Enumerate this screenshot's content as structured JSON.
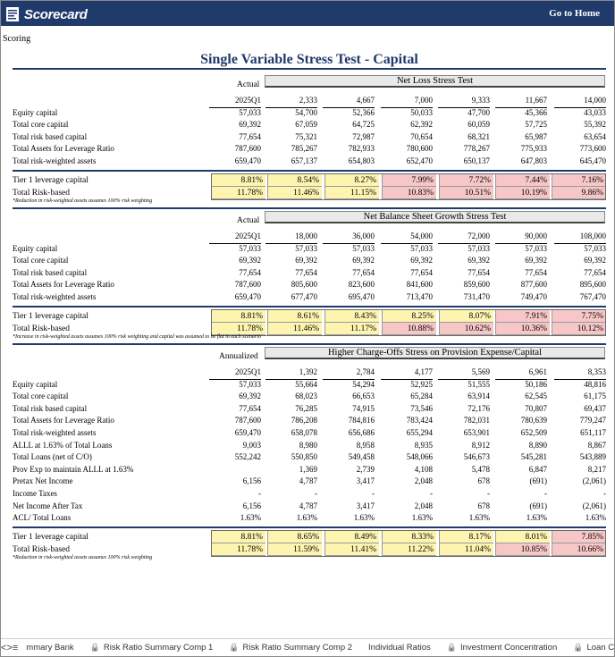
{
  "header": {
    "logo_text": "Scorecard",
    "go_home": "Go to Home"
  },
  "breadcrumb": "Scoring",
  "page_title": "Single Variable Stress Test - Capital",
  "sections": [
    {
      "left_label": "Actual",
      "box_title": "Net Loss Stress Test",
      "columns": [
        "2025Q1",
        "2,333",
        "4,667",
        "7,000",
        "9,333",
        "11,667",
        "14,000"
      ],
      "rows": [
        {
          "label": "Equity capital",
          "values": [
            "57,033",
            "54,700",
            "52,366",
            "50,033",
            "47,700",
            "45,366",
            "43,033"
          ]
        },
        {
          "label": "Total core capital",
          "values": [
            "69,392",
            "67,059",
            "64,725",
            "62,392",
            "60,059",
            "57,725",
            "55,392"
          ]
        },
        {
          "label": "Total risk based capital",
          "values": [
            "77,654",
            "75,321",
            "72,987",
            "70,654",
            "68,321",
            "65,987",
            "63,654"
          ]
        },
        {
          "label": "Total Assets for Leverage Ratio",
          "values": [
            "787,600",
            "785,267",
            "782,933",
            "780,600",
            "778,267",
            "775,933",
            "773,600"
          ]
        },
        {
          "label": "Total risk-weighted assets",
          "values": [
            "659,470",
            "657,137",
            "654,803",
            "652,470",
            "650,137",
            "647,803",
            "645,470"
          ]
        }
      ],
      "ratios": [
        {
          "label": "Tier 1 leverage capital",
          "values": [
            "8.81%",
            "8.54%",
            "8.27%",
            "7.99%",
            "7.72%",
            "7.44%",
            "7.16%"
          ],
          "colors": [
            "y",
            "y",
            "y",
            "p",
            "p",
            "p",
            "p"
          ]
        },
        {
          "label": "Total Risk-based",
          "values": [
            "11.78%",
            "11.46%",
            "11.15%",
            "10.83%",
            "10.51%",
            "10.19%",
            "9.86%"
          ],
          "colors": [
            "y",
            "y",
            "y",
            "p",
            "p",
            "p",
            "p"
          ]
        }
      ],
      "footnote": "*Reduction in risk-weighted assets assumes 100% risk weighting"
    },
    {
      "left_label": "Actual",
      "box_title": "Net Balance Sheet Growth Stress Test",
      "columns": [
        "2025Q1",
        "18,000",
        "36,000",
        "54,000",
        "72,000",
        "90,000",
        "108,000"
      ],
      "rows": [
        {
          "label": "Equity capital",
          "values": [
            "57,033",
            "57,033",
            "57,033",
            "57,033",
            "57,033",
            "57,033",
            "57,033"
          ]
        },
        {
          "label": "Total core capital",
          "values": [
            "69,392",
            "69,392",
            "69,392",
            "69,392",
            "69,392",
            "69,392",
            "69,392"
          ]
        },
        {
          "label": "Total risk based capital",
          "values": [
            "77,654",
            "77,654",
            "77,654",
            "77,654",
            "77,654",
            "77,654",
            "77,654"
          ]
        },
        {
          "label": "Total Assets for Leverage Ratio",
          "values": [
            "787,600",
            "805,600",
            "823,600",
            "841,600",
            "859,600",
            "877,600",
            "895,600"
          ]
        },
        {
          "label": "Total risk-weighted assets",
          "values": [
            "659,470",
            "677,470",
            "695,470",
            "713,470",
            "731,470",
            "749,470",
            "767,470"
          ]
        }
      ],
      "ratios": [
        {
          "label": "Tier 1 leverage capital",
          "values": [
            "8.81%",
            "8.61%",
            "8.43%",
            "8.25%",
            "8.07%",
            "7.91%",
            "7.75%"
          ],
          "colors": [
            "y",
            "y",
            "y",
            "y",
            "y",
            "p",
            "p"
          ]
        },
        {
          "label": "Total Risk-based",
          "values": [
            "11.78%",
            "11.46%",
            "11.17%",
            "10.88%",
            "10.62%",
            "10.36%",
            "10.12%"
          ],
          "colors": [
            "y",
            "y",
            "y",
            "p",
            "p",
            "p",
            "p"
          ]
        }
      ],
      "footnote": "*Increase in risk-weighted assets assumes 100% risk weighting and capital was assumed to be flat in each scenario"
    },
    {
      "left_label": "Annualized",
      "box_title": "Higher Charge-Offs Stress on Provision Expense/Capital",
      "columns": [
        "2025Q1",
        "1,392",
        "2,784",
        "4,177",
        "5,569",
        "6,961",
        "8,353"
      ],
      "rows": [
        {
          "label": "Equity capital",
          "values": [
            "57,033",
            "55,664",
            "54,294",
            "52,925",
            "51,555",
            "50,186",
            "48,816"
          ]
        },
        {
          "label": "Total core capital",
          "values": [
            "69,392",
            "68,023",
            "66,653",
            "65,284",
            "63,914",
            "62,545",
            "61,175"
          ]
        },
        {
          "label": "Total risk based capital",
          "values": [
            "77,654",
            "76,285",
            "74,915",
            "73,546",
            "72,176",
            "70,807",
            "69,437"
          ]
        },
        {
          "label": "Total Assets for Leverage Ratio",
          "values": [
            "787,600",
            "786,208",
            "784,816",
            "783,424",
            "782,031",
            "780,639",
            "779,247"
          ]
        },
        {
          "label": "Total risk-weighted assets",
          "values": [
            "659,470",
            "658,078",
            "656,686",
            "655,294",
            "653,901",
            "652,509",
            "651,117"
          ]
        },
        {
          "label": "ALLL at 1.63% of Total Loans",
          "values": [
            "9,003",
            "8,980",
            "8,958",
            "8,935",
            "8,912",
            "8,890",
            "8,867"
          ]
        },
        {
          "label": "Total Loans (net of C/O)",
          "values": [
            "552,242",
            "550,850",
            "549,458",
            "548,066",
            "546,673",
            "545,281",
            "543,889"
          ]
        },
        {
          "label": "Prov Exp to maintain ALLL at 1.63%",
          "values": [
            "",
            "1,369",
            "2,739",
            "4,108",
            "5,478",
            "6,847",
            "8,217"
          ]
        },
        {
          "label": "Pretax Net Income",
          "values": [
            "6,156",
            "4,787",
            "3,417",
            "2,048",
            "678",
            "(691)",
            "(2,061)"
          ]
        },
        {
          "label": "Income Taxes",
          "values": [
            "-",
            "-",
            "-",
            "-",
            "-",
            "-",
            "-"
          ]
        },
        {
          "label": "Net Income After Tax",
          "values": [
            "6,156",
            "4,787",
            "3,417",
            "2,048",
            "678",
            "(691)",
            "(2,061)"
          ]
        },
        {
          "label": "ACL/ Total Loans",
          "values": [
            "1.63%",
            "1.63%",
            "1.63%",
            "1.63%",
            "1.63%",
            "1.63%",
            "1.63%"
          ]
        }
      ],
      "ratios": [
        {
          "label": "Tier 1 leverage capital",
          "values": [
            "8.81%",
            "8.65%",
            "8.49%",
            "8.33%",
            "8.17%",
            "8.01%",
            "7.85%"
          ],
          "colors": [
            "y",
            "y",
            "y",
            "y",
            "y",
            "y",
            "p"
          ]
        },
        {
          "label": "Total Risk-based",
          "values": [
            "11.78%",
            "11.59%",
            "11.41%",
            "11.22%",
            "11.04%",
            "10.85%",
            "10.66%"
          ],
          "colors": [
            "y",
            "y",
            "y",
            "y",
            "y",
            "p",
            "p"
          ]
        }
      ],
      "footnote": "*Reduction in risk-weighted assets assumes 100% risk weighting"
    }
  ],
  "tabs": {
    "prev": "<",
    "next": ">",
    "menu": "≡",
    "items": [
      {
        "label": "mmary Bank",
        "locked": false
      },
      {
        "label": "Risk Ratio Summary Comp 1",
        "locked": true
      },
      {
        "label": "Risk Ratio Summary Comp 2",
        "locked": true
      },
      {
        "label": "Individual Ratios",
        "locked": false
      },
      {
        "label": "Investment Concentration",
        "locked": true
      },
      {
        "label": "Loan Co",
        "locked": true
      }
    ]
  },
  "colors": {
    "navy": "#1f3a6b",
    "yellow": "#fdf4b0",
    "pink": "#f7c6c6"
  }
}
